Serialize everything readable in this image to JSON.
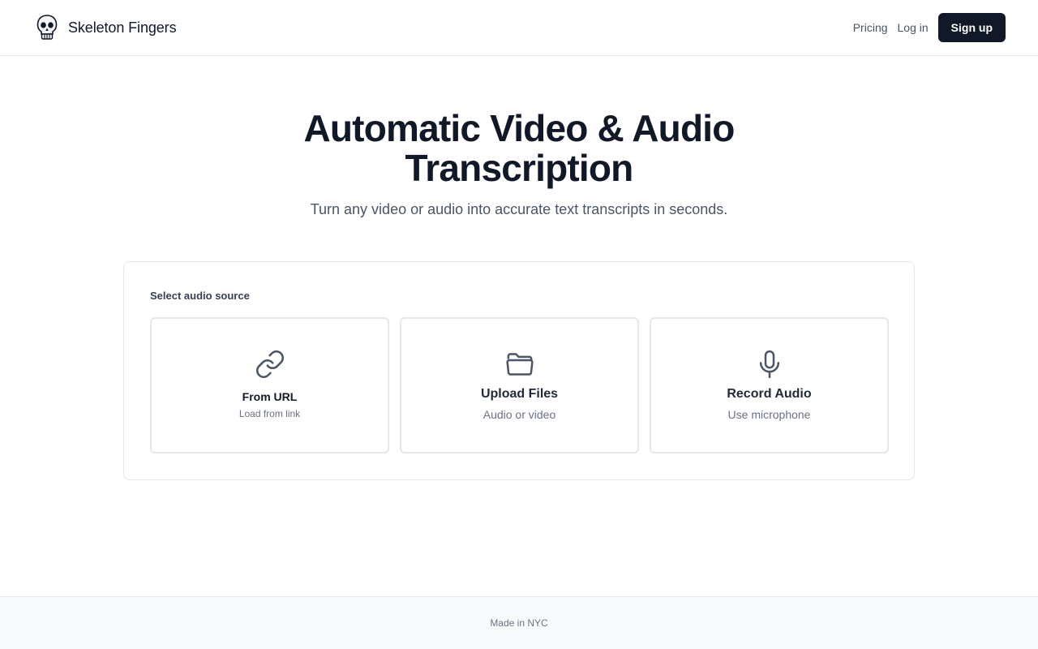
{
  "header": {
    "brand_name": "Skeleton Fingers",
    "logo_icon": "skull-icon",
    "nav": {
      "pricing": "Pricing",
      "login": "Log in",
      "signup": "Sign up"
    }
  },
  "hero": {
    "title": "Automatic Video & Audio Transcription",
    "subtitle": "Turn any video or audio into accurate text transcripts in seconds."
  },
  "source_card": {
    "label": "Select audio source",
    "options": [
      {
        "icon": "link-icon",
        "title": "From URL",
        "description": "Load from link"
      },
      {
        "icon": "folder-icon",
        "title": "Upload Files",
        "description": "Audio or video"
      },
      {
        "icon": "microphone-icon",
        "title": "Record Audio",
        "description": "Use microphone"
      }
    ]
  },
  "footer": {
    "text": "Made in NYC"
  },
  "colors": {
    "primary": "#111827",
    "muted_text": "#6b7280",
    "border": "#e5e7eb",
    "footer_bg": "#f9fafb"
  }
}
